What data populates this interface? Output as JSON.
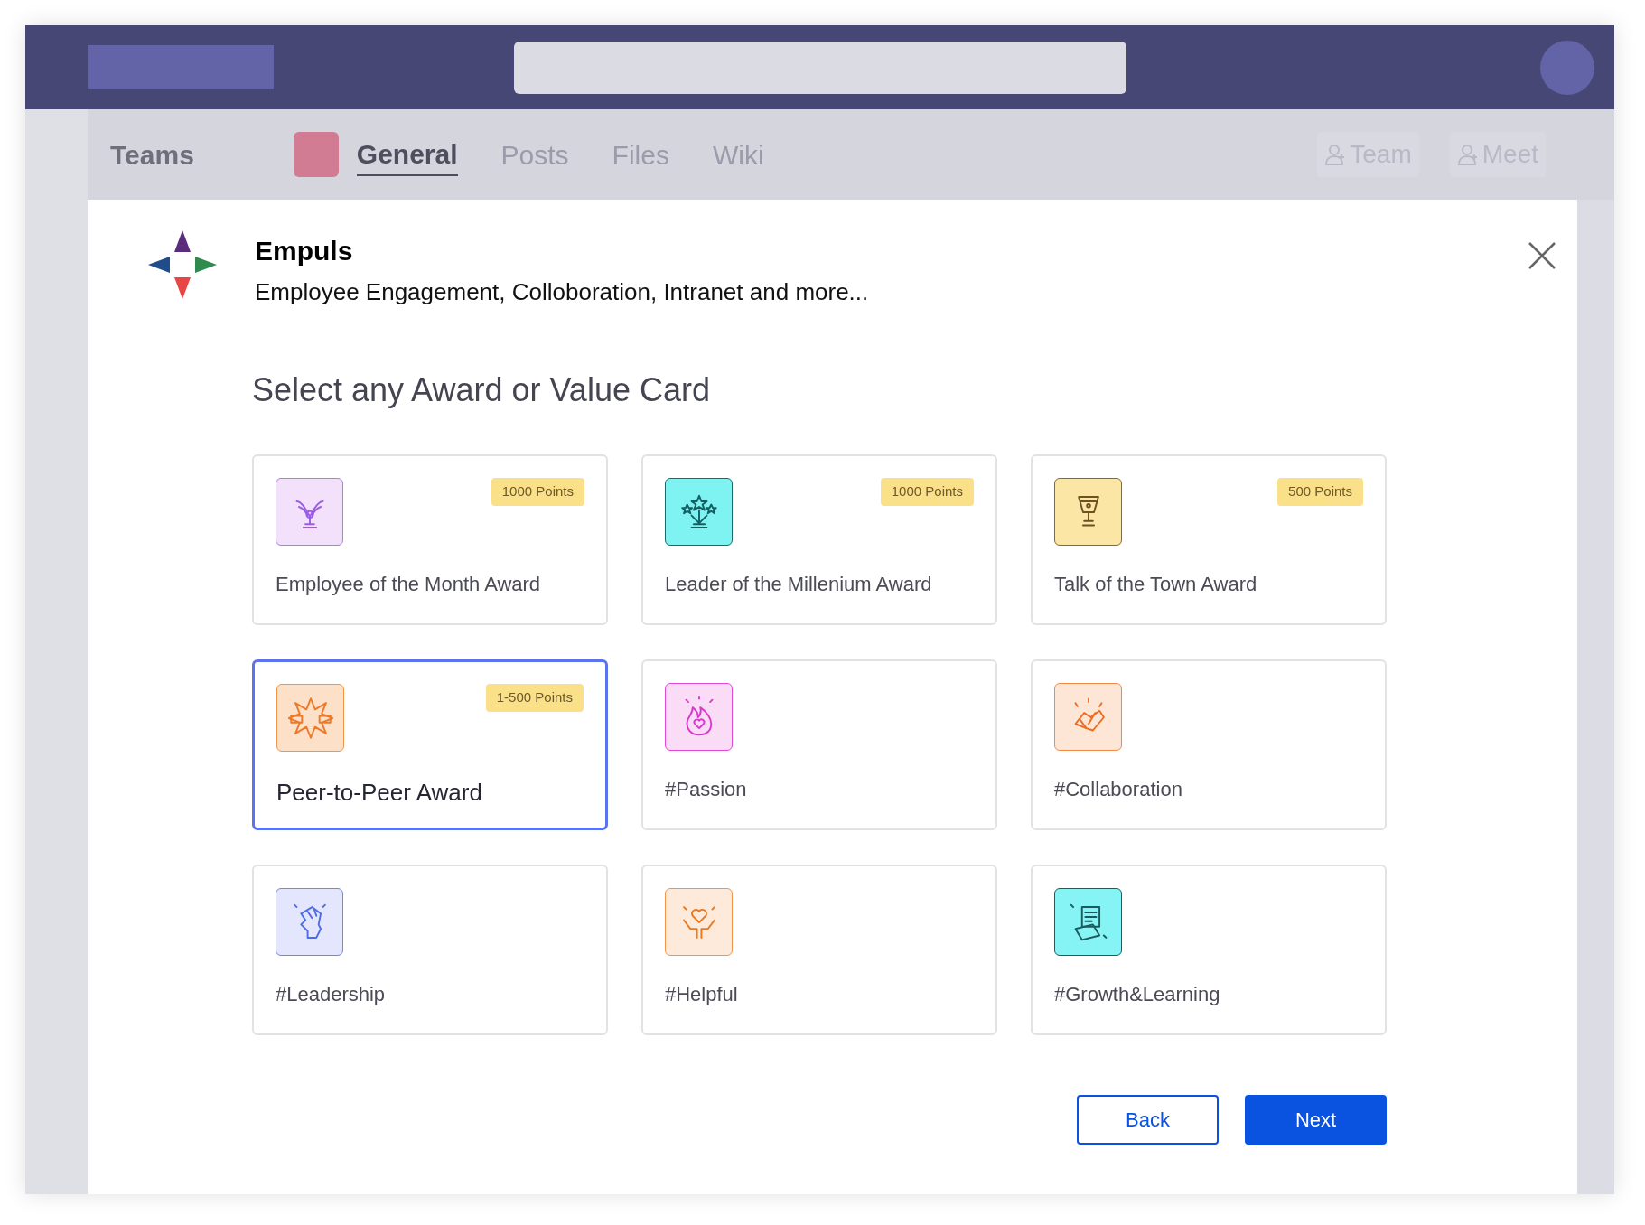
{
  "header": {
    "tabs": [
      {
        "label": "Teams",
        "kind": "app",
        "selected": false
      },
      {
        "label": "General",
        "kind": "channel",
        "selected": true
      },
      {
        "label": "Posts",
        "kind": "tab",
        "selected": false
      },
      {
        "label": "Files",
        "kind": "tab",
        "selected": false
      },
      {
        "label": "Wiki",
        "kind": "tab",
        "selected": false
      }
    ],
    "actions": [
      "Team",
      "Meet"
    ]
  },
  "app": {
    "name": "Empuls",
    "tagline": "Employee Engagement, Colloboration, Intranet and more..."
  },
  "heading": "Select any Award or Value Card",
  "cards": [
    {
      "title": "Employee of the Month Award",
      "points": "1000 Points",
      "selected": false
    },
    {
      "title": "Leader of the Millenium Award",
      "points": "1000 Points",
      "selected": false
    },
    {
      "title": "Talk of the Town Award",
      "points": "500 Points",
      "selected": false
    },
    {
      "title": "Peer-to-Peer Award",
      "points": "1-500 Points",
      "selected": true
    },
    {
      "title": "#Passion",
      "selected": false
    },
    {
      "title": "#Collaboration",
      "selected": false
    },
    {
      "title": "#Leadership",
      "selected": false
    },
    {
      "title": "#Helpful",
      "selected": false
    },
    {
      "title": "#Growth&Learning",
      "selected": false
    }
  ],
  "buttons": [
    {
      "label": "Back",
      "kind": "secondary"
    },
    {
      "label": "Next",
      "kind": "primary"
    }
  ]
}
